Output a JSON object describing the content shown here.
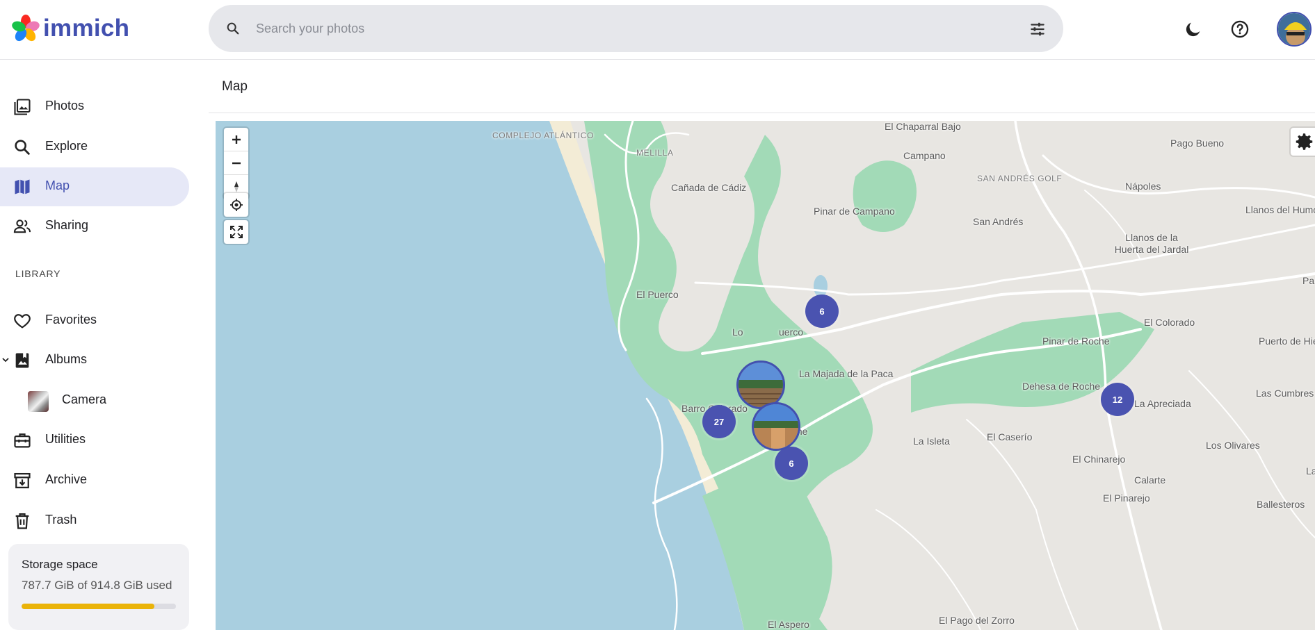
{
  "app": {
    "name": "immich"
  },
  "header": {
    "search_placeholder": "Search your photos",
    "icons": [
      "search-icon",
      "tune-icon",
      "moon-icon",
      "help-icon",
      "avatar"
    ]
  },
  "sidebar": {
    "items": [
      {
        "label": "Photos",
        "icon": "photos-icon"
      },
      {
        "label": "Explore",
        "icon": "search-icon"
      },
      {
        "label": "Map",
        "icon": "map-icon",
        "active": true
      },
      {
        "label": "Sharing",
        "icon": "people-icon"
      }
    ],
    "library_heading": "LIBRARY",
    "library_items": [
      {
        "label": "Favorites",
        "icon": "heart-icon"
      },
      {
        "label": "Albums",
        "icon": "album-icon"
      },
      {
        "label": "Camera",
        "icon": "album-thumbnail"
      },
      {
        "label": "Utilities",
        "icon": "toolbox-icon"
      },
      {
        "label": "Archive",
        "icon": "archive-icon"
      },
      {
        "label": "Trash",
        "icon": "trash-icon"
      }
    ],
    "storage": {
      "title": "Storage space",
      "used_text": "787.7 GiB of 914.8 GiB used",
      "used_fraction": 0.861
    }
  },
  "main": {
    "title": "Map"
  },
  "map": {
    "places": [
      "COMPLEJO ATLÁNTICO",
      "MELILLA",
      "El Chaparral Bajo",
      "Campano",
      "Pago Bueno",
      "SAN ANDRÉS GOLF",
      "Cañada de Cádiz",
      "Pinar de Campano",
      "Nápoles",
      "Llanos del Humo",
      "San Andrés",
      "Llanos de la Huerta del Jardal",
      "Pa",
      "El Puerco",
      "Lo",
      "uerco",
      "El Colorado",
      "Pinar de Roche",
      "Puerto de Hier",
      "La Majada de la Paca",
      "Dehesa de Roche",
      "Las Cumbres",
      "Barro Colorado",
      "La Apreciada",
      "Roche",
      "La Isleta",
      "El Caserío",
      "Los Olivares",
      "El Chinarejo",
      "Calarte",
      "El Pinarejo",
      "Ballesteros",
      "La",
      "El Aspero",
      "El Pago del Zorro"
    ],
    "clusters": [
      "6",
      "27",
      "6",
      "12"
    ],
    "colors": {
      "water": "#a9cfe0",
      "land": "#e8e6e2",
      "green": "#a2dab7",
      "cluster": "#4a53b0",
      "accent": "#4250af"
    }
  }
}
